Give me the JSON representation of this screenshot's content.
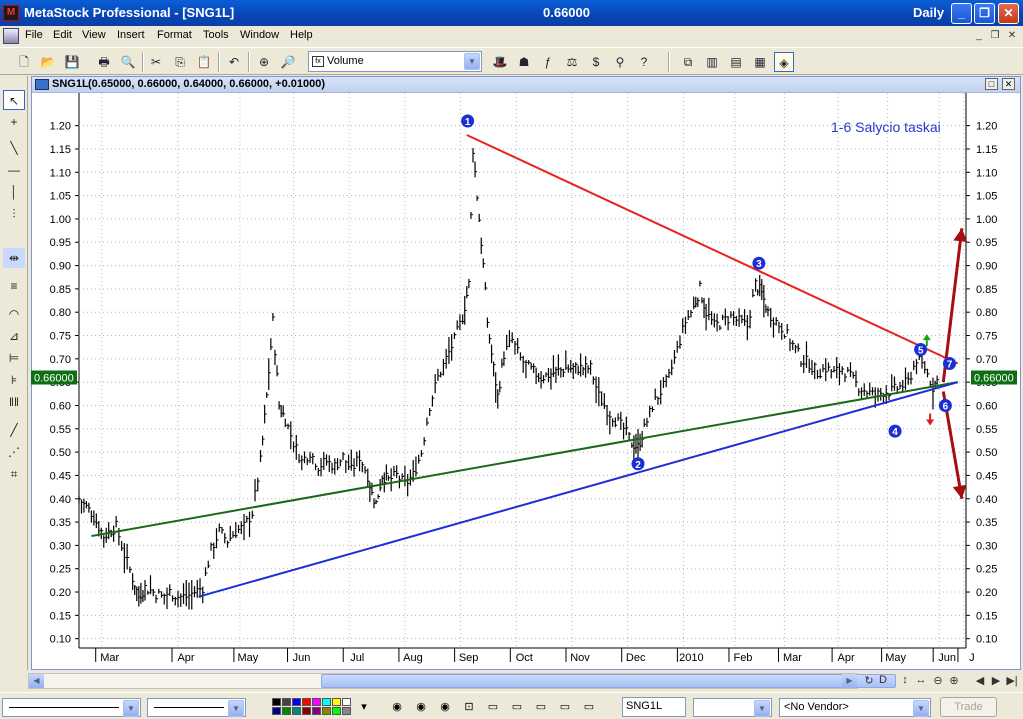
{
  "window": {
    "title": "MetaStock Professional - [SNG1L]",
    "center_value": "0.66000",
    "period": "Daily"
  },
  "menu": [
    "File",
    "Edit",
    "View",
    "Insert",
    "Format",
    "Tools",
    "Window",
    "Help"
  ],
  "toolbar": {
    "indicator": "Volume"
  },
  "chart_window": {
    "security": "SNG1L",
    "ohlc": "(0.65000, 0.66000, 0.64000, 0.66000, +0.01000)"
  },
  "chart_data": {
    "type": "bar",
    "security": "SNG1L",
    "annotation": "1-6 Salycio taskai",
    "current_price_label": "0.66000",
    "ylim": [
      0.08,
      1.27
    ],
    "y_ticks": [
      "1.20",
      "1.15",
      "1.10",
      "1.05",
      "1.00",
      "0.95",
      "0.90",
      "0.85",
      "0.80",
      "0.75",
      "0.70",
      "0.65",
      "0.60",
      "0.55",
      "0.50",
      "0.45",
      "0.40",
      "0.35",
      "0.30",
      "0.25",
      "0.20",
      "0.15",
      "0.10"
    ],
    "x_ticks": [
      "Mar",
      "Apr",
      "May",
      "Jun",
      "Jul",
      "Aug",
      "Sep",
      "Oct",
      "Nov",
      "Dec",
      "2010",
      "Feb",
      "Mar",
      "Apr",
      "May",
      "Jun",
      "J"
    ],
    "price_path": [
      [
        0.0,
        0.4
      ],
      [
        0.3,
        0.37
      ],
      [
        0.6,
        0.32
      ],
      [
        0.9,
        0.34
      ],
      [
        1.1,
        0.28
      ],
      [
        1.3,
        0.23
      ],
      [
        1.45,
        0.19
      ],
      [
        1.6,
        0.21
      ],
      [
        1.8,
        0.2
      ],
      [
        2.0,
        0.19
      ],
      [
        2.2,
        0.2
      ],
      [
        2.4,
        0.19
      ],
      [
        2.6,
        0.19
      ],
      [
        2.8,
        0.2
      ],
      [
        3.0,
        0.21
      ],
      [
        3.2,
        0.29
      ],
      [
        3.4,
        0.33
      ],
      [
        3.6,
        0.31
      ],
      [
        3.8,
        0.33
      ],
      [
        4.0,
        0.34
      ],
      [
        4.2,
        0.37
      ],
      [
        4.4,
        0.48
      ],
      [
        4.55,
        0.62
      ],
      [
        4.7,
        0.78
      ],
      [
        4.85,
        0.6
      ],
      [
        5.0,
        0.57
      ],
      [
        5.2,
        0.52
      ],
      [
        5.4,
        0.48
      ],
      [
        5.6,
        0.5
      ],
      [
        5.8,
        0.47
      ],
      [
        6.0,
        0.48
      ],
      [
        6.2,
        0.47
      ],
      [
        6.4,
        0.49
      ],
      [
        6.6,
        0.46
      ],
      [
        6.8,
        0.49
      ],
      [
        7.0,
        0.45
      ],
      [
        7.1,
        0.41
      ],
      [
        7.2,
        0.39
      ],
      [
        7.35,
        0.45
      ],
      [
        7.5,
        0.44
      ],
      [
        7.7,
        0.45
      ],
      [
        7.9,
        0.43
      ],
      [
        8.1,
        0.45
      ],
      [
        8.3,
        0.5
      ],
      [
        8.5,
        0.6
      ],
      [
        8.7,
        0.66
      ],
      [
        8.9,
        0.7
      ],
      [
        9.1,
        0.74
      ],
      [
        9.3,
        0.79
      ],
      [
        9.45,
        0.86
      ],
      [
        9.55,
        1.15
      ],
      [
        9.7,
        1.0
      ],
      [
        9.8,
        0.9
      ],
      [
        9.9,
        0.78
      ],
      [
        10.0,
        0.71
      ],
      [
        10.15,
        0.62
      ],
      [
        10.3,
        0.71
      ],
      [
        10.5,
        0.74
      ],
      [
        10.7,
        0.7
      ],
      [
        10.9,
        0.68
      ],
      [
        11.2,
        0.66
      ],
      [
        11.5,
        0.67
      ],
      [
        11.8,
        0.68
      ],
      [
        12.1,
        0.68
      ],
      [
        12.4,
        0.68
      ],
      [
        12.6,
        0.62
      ],
      [
        12.8,
        0.59
      ],
      [
        13.0,
        0.57
      ],
      [
        13.2,
        0.55
      ],
      [
        13.4,
        0.52
      ],
      [
        13.55,
        0.51
      ],
      [
        13.7,
        0.55
      ],
      [
        13.9,
        0.6
      ],
      [
        14.1,
        0.63
      ],
      [
        14.3,
        0.66
      ],
      [
        14.5,
        0.72
      ],
      [
        14.7,
        0.78
      ],
      [
        14.9,
        0.81
      ],
      [
        15.05,
        0.85
      ],
      [
        15.2,
        0.8
      ],
      [
        15.4,
        0.77
      ],
      [
        15.6,
        0.78
      ],
      [
        15.8,
        0.79
      ],
      [
        16.0,
        0.78
      ],
      [
        16.2,
        0.77
      ],
      [
        16.4,
        0.86
      ],
      [
        16.55,
        0.84
      ],
      [
        16.7,
        0.8
      ],
      [
        16.9,
        0.78
      ],
      [
        17.1,
        0.76
      ],
      [
        17.3,
        0.73
      ],
      [
        17.5,
        0.7
      ],
      [
        17.7,
        0.69
      ],
      [
        17.9,
        0.67
      ],
      [
        18.1,
        0.68
      ],
      [
        18.3,
        0.67
      ],
      [
        18.5,
        0.68
      ],
      [
        18.7,
        0.66
      ],
      [
        18.9,
        0.64
      ],
      [
        19.1,
        0.63
      ],
      [
        19.3,
        0.62
      ],
      [
        19.5,
        0.63
      ],
      [
        19.7,
        0.63
      ],
      [
        19.9,
        0.64
      ],
      [
        20.1,
        0.65
      ],
      [
        20.3,
        0.7
      ],
      [
        20.5,
        0.68
      ],
      [
        20.7,
        0.64
      ],
      [
        20.85,
        0.66
      ]
    ],
    "lines": [
      {
        "name": "resistance",
        "color": "#e8241f",
        "from": [
          9.4,
          1.18
        ],
        "to": [
          21.3,
          0.69
        ]
      },
      {
        "name": "support-green",
        "color": "#1b6a1b",
        "from": [
          0.3,
          0.32
        ],
        "to": [
          21.3,
          0.65
        ]
      },
      {
        "name": "support-blue",
        "color": "#1c2fd6",
        "from": [
          2.9,
          0.19
        ],
        "to": [
          21.3,
          0.65
        ]
      }
    ],
    "points": [
      {
        "label": "1",
        "x": 9.42,
        "y": 1.21
      },
      {
        "label": "2",
        "x": 13.55,
        "y": 0.475
      },
      {
        "label": "3",
        "x": 16.48,
        "y": 0.905
      },
      {
        "label": "4",
        "x": 19.78,
        "y": 0.545
      },
      {
        "label": "5",
        "x": 20.4,
        "y": 0.72
      },
      {
        "label": "6",
        "x": 21.0,
        "y": 0.6
      },
      {
        "label": "7",
        "x": 21.1,
        "y": 0.69
      }
    ],
    "arrows": [
      {
        "name": "up-arrow",
        "color": "#a50f0f",
        "from": [
          20.95,
          0.65
        ],
        "to": [
          21.4,
          0.98
        ]
      },
      {
        "name": "down-arrow",
        "color": "#a50f0f",
        "from": [
          20.95,
          0.63
        ],
        "to": [
          21.4,
          0.4
        ]
      }
    ]
  },
  "status": {
    "security_field": "SNG1L",
    "vendor": "<No Vendor>",
    "trade_label": "Trade"
  }
}
